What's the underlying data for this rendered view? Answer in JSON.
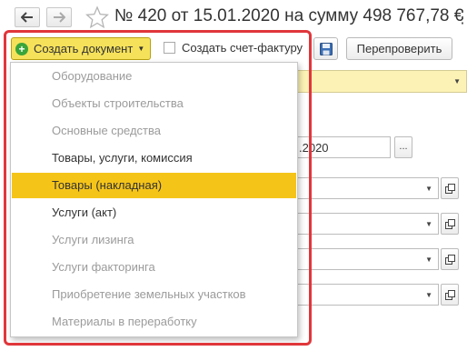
{
  "header": {
    "back_icon": "arrow-left-icon",
    "forward_icon": "arrow-right-icon",
    "favorite_icon": "star-icon",
    "title": "№ 420 от 15.01.2020 на сумму 498 767,78 €",
    "more_icon": "more-vertical-icon"
  },
  "toolbar": {
    "create_document_label": "Создать документ",
    "create_invoice_label": "Создать счет-фактуру",
    "save_icon": "floppy-disk-icon",
    "recheck_label": "Перепроверить"
  },
  "form": {
    "date_value_fragment": ".2020",
    "dots_label": "..."
  },
  "menu": {
    "items": [
      {
        "label": "Оборудование",
        "state": "disabled"
      },
      {
        "label": "Объекты строительства",
        "state": "disabled"
      },
      {
        "label": "Основные средства",
        "state": "disabled"
      },
      {
        "label": "Товары, услуги, комиссия",
        "state": "enabled"
      },
      {
        "label": "Товары (накладная)",
        "state": "selected"
      },
      {
        "label": "Услуги (акт)",
        "state": "enabled"
      },
      {
        "label": "Услуги лизинга",
        "state": "disabled"
      },
      {
        "label": "Услуги факторинга",
        "state": "disabled"
      },
      {
        "label": "Приобретение земельных участков",
        "state": "disabled"
      },
      {
        "label": "Материалы в переработку",
        "state": "disabled"
      }
    ]
  },
  "colors": {
    "accent_yellow": "#f5c419",
    "create_button": "#f6e25a",
    "highlight_frame": "#e0363b",
    "plus_green": "#3aa53a"
  }
}
